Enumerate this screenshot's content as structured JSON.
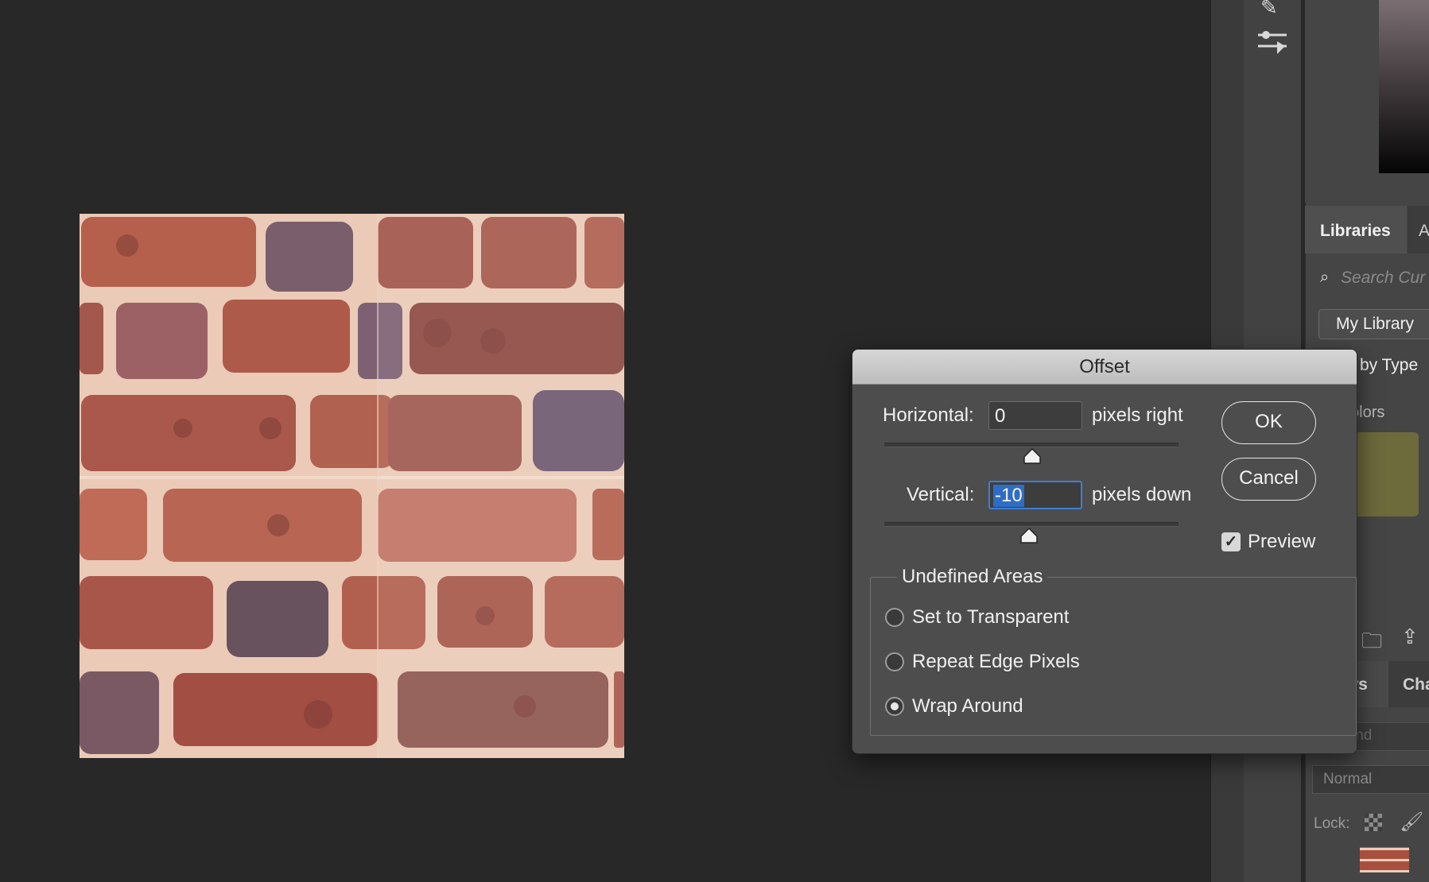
{
  "dialog": {
    "title": "Offset",
    "horizontal_label": "Horizontal:",
    "horizontal_value": "0",
    "horizontal_unit": "pixels right",
    "vertical_label": "Vertical:",
    "vertical_value": "-10",
    "vertical_unit": "pixels down",
    "ok_label": "OK",
    "cancel_label": "Cancel",
    "preview_label": "Preview",
    "preview_checked": true,
    "undefined_areas_label": "Undefined Areas",
    "options": [
      {
        "label": "Set to Transparent",
        "selected": false
      },
      {
        "label": "Repeat Edge Pixels",
        "selected": false
      },
      {
        "label": "Wrap Around",
        "selected": true
      }
    ]
  },
  "libraries": {
    "tab_label": "Libraries",
    "tab2_label": "A",
    "search_placeholder": "Search Cur",
    "library_select": "My Library",
    "group_by": "by Type",
    "colors_label": "olors",
    "swatch_color": "#6d6a3c"
  },
  "layers": {
    "tab_label": "rs",
    "channels_tab_label": "Cha",
    "find_placeholder": "ind",
    "blend_mode": "Normal",
    "lock_label": "Lock:"
  },
  "icons": [
    "brush-icon",
    "sliders-icon",
    "search-icon",
    "folder-icon",
    "upload-icon",
    "lock-pixels-icon",
    "lock-brush-icon"
  ]
}
